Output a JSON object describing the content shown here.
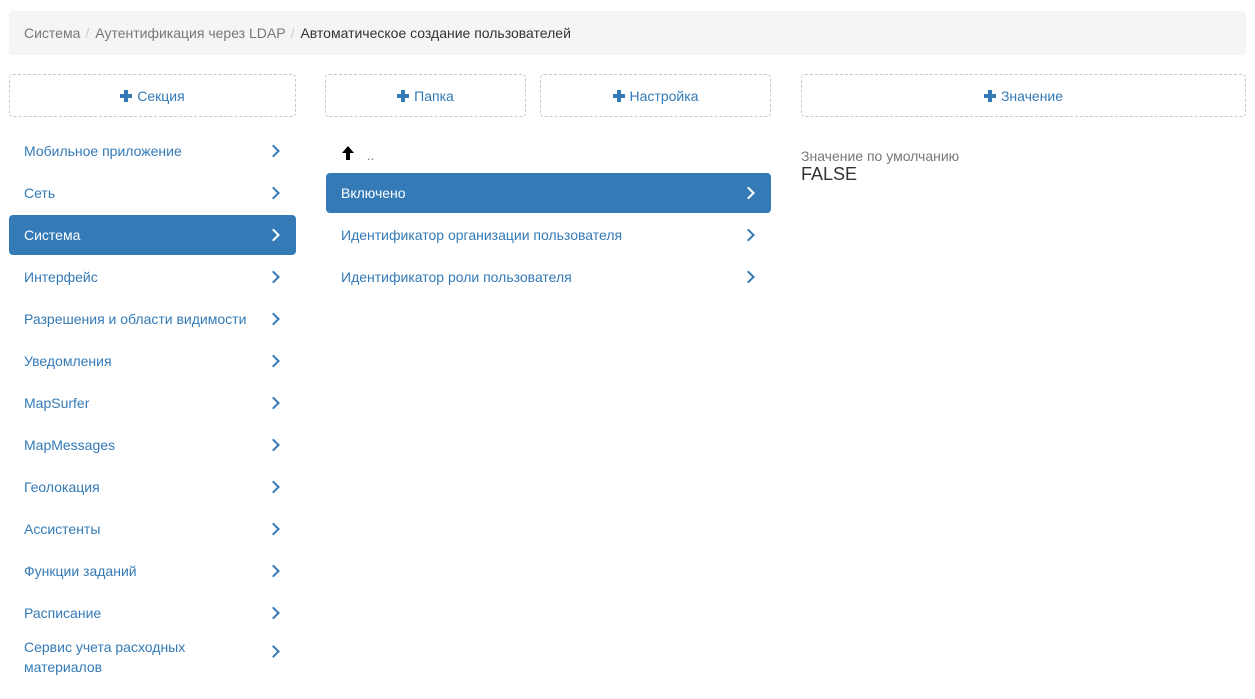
{
  "breadcrumb": {
    "items": [
      "Система",
      "Аутентификация через LDAP"
    ],
    "current": "Автоматическое создание пользователей",
    "separator": "/"
  },
  "buttons": {
    "add_section": "Секция",
    "add_folder": "Папка",
    "add_setting": "Настройка",
    "add_value": "Значение"
  },
  "sections": [
    "Мобильное приложение",
    "Сеть",
    "Система",
    "Интерфейс",
    "Разрешения и области видимости",
    "Уведомления",
    "MapSurfer",
    "MapMessages",
    "Геолокация",
    "Ассистенты",
    "Функции заданий",
    "Расписание",
    "Сервис учета расходных материалов"
  ],
  "sections_active": "Система",
  "settings": {
    "up_label": "..",
    "items": [
      "Включено",
      "Идентификатор организации пользователя",
      "Идентификатор роли пользователя"
    ],
    "active": "Включено"
  },
  "value": {
    "label": "Значение по умолчанию",
    "value": "FALSE"
  },
  "colors": {
    "accent": "#337ab7",
    "breadcrumb_bg": "#f5f5f5",
    "muted_text": "#777777"
  }
}
